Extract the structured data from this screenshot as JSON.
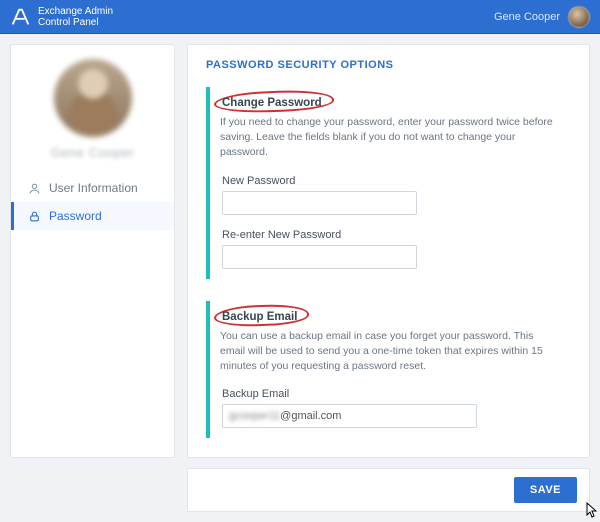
{
  "header": {
    "app_title_line1": "Exchange Admin",
    "app_title_line2": "Control Panel",
    "user_display_name": "Gene Cooper"
  },
  "sidebar": {
    "profile_name": "Gene Cooper",
    "items": [
      {
        "label": "User Information",
        "active": false,
        "icon": "user-icon"
      },
      {
        "label": "Password",
        "active": true,
        "icon": "lock-icon"
      }
    ]
  },
  "main": {
    "title": "PASSWORD SECURITY OPTIONS",
    "sections": {
      "change_password": {
        "heading": "Change Password",
        "description": "If you need to change your password, enter your password twice before saving. Leave the fields blank if you do not want to change your password.",
        "new_password_label": "New Password",
        "new_password_value": "",
        "reenter_label": "Re-enter New Password",
        "reenter_value": ""
      },
      "backup_email": {
        "heading": "Backup Email",
        "description": "You can use a backup email in case you forget your password. This email will be used to send you a one-time token that expires within 15 minutes of you requesting a password reset.",
        "label": "Backup Email",
        "value_local": "gcooper11",
        "value_domain": "@gmail.com"
      }
    }
  },
  "footer": {
    "save_label": "SAVE"
  },
  "annotations": {
    "circled_sections": [
      "change_password",
      "backup_email"
    ]
  },
  "colors": {
    "primary": "#2c6fd1",
    "accent_teal": "#1fbdc2",
    "annotation_red": "#d13030"
  }
}
